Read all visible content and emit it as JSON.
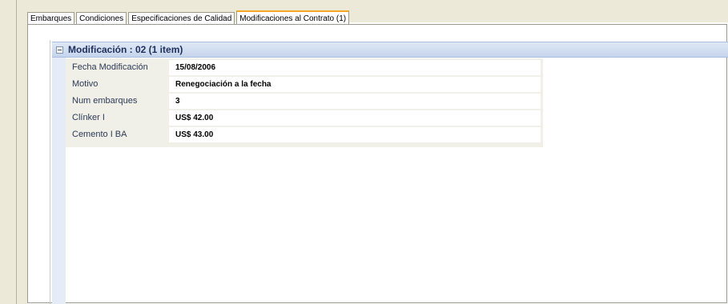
{
  "tabs": [
    {
      "label": "Embarques",
      "active": false
    },
    {
      "label": "Condiciones",
      "active": false
    },
    {
      "label": "Especificaciones de Calidad",
      "active": false
    },
    {
      "label": "Modificaciones al Contrato (1)",
      "active": true
    }
  ],
  "group": {
    "title": "Modificación : 02 (1 item)"
  },
  "properties": [
    {
      "label": "Fecha Modificación",
      "value": "15/08/2006"
    },
    {
      "label": "Motivo",
      "value": "Renegociación a la fecha"
    },
    {
      "label": "Num embarques",
      "value": "3"
    },
    {
      "label": "Clínker I",
      "value": "US$ 42.00"
    },
    {
      "label": "Cemento I BA",
      "value": "US$ 43.00"
    }
  ],
  "colors": {
    "active_tab_accent": "#f5a623",
    "group_header_bg": "#c5d4ec",
    "window_bg": "#ece9d8"
  },
  "icons": {
    "collapse": "minus-box-icon"
  }
}
